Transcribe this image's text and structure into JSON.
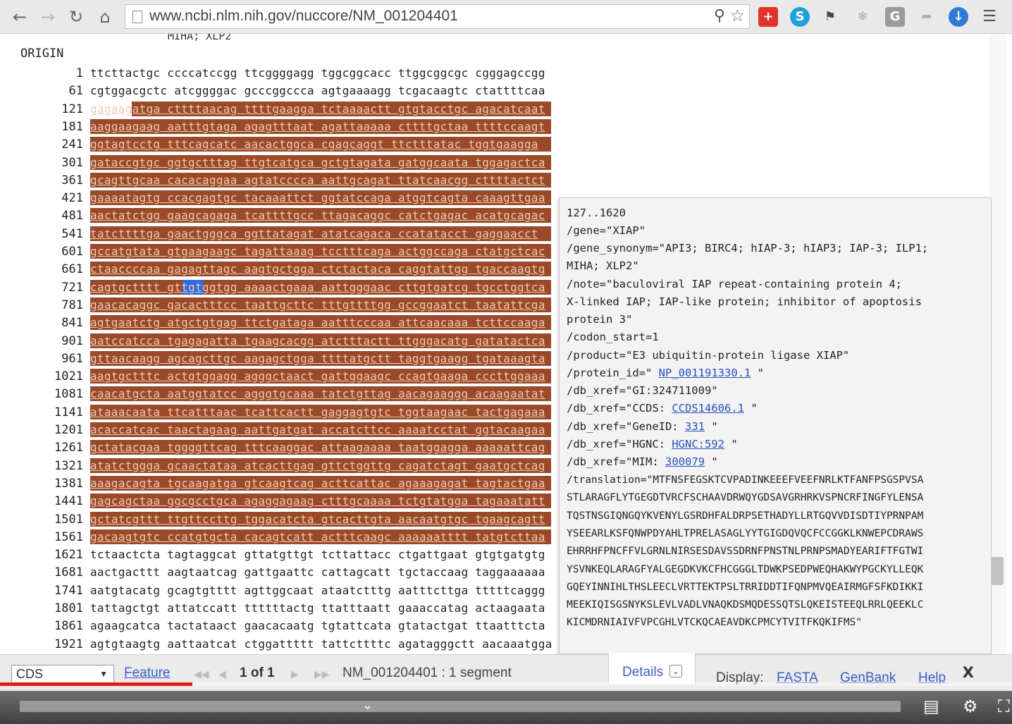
{
  "browser": {
    "url": "www.ncbi.nlm.nih.gov/nuccore/NM_001204401",
    "back_icon": "back-arrow-icon",
    "forward_icon": "forward-arrow-icon",
    "reload_icon": "reload-icon",
    "home_icon": "home-icon",
    "extensions": [
      "plus-extension-icon",
      "skype-icon",
      "puzzle-icon",
      "snowflake-icon",
      "g-icon",
      "share-icon",
      "download-icon",
      "menu-icon"
    ]
  },
  "sequence": {
    "cutoff_text": "MIHA; XLP2",
    "origin_label": "ORIGIN",
    "rows": [
      {
        "num": "1",
        "bases": "ttcttactgc ccccatccgg ttcggggagg tggcggcacc ttggcggcgc cgggagccgg",
        "hl": "none"
      },
      {
        "num": "61",
        "bases": "cgtggacgctc atcggggac gcccggccca agtgaaaagg tcgacaagtc ctattttcaa",
        "hl": "none"
      },
      {
        "num": "121",
        "bases": "gagaagatga cttttaacag ttttgaagga tctaaaactt gtgtacctgc agacatcaat",
        "hl": "part"
      },
      {
        "num": "181",
        "bases": "aaggaagaag aatttgtaga agagtttaat agattaaaaa cttttgctaa ttttccaagt",
        "hl": "full"
      },
      {
        "num": "241",
        "bases": "ggtagtcctg tttcagcatc aacactggca cgagcaggt ttctttatac tggtgaagga",
        "hl": "full"
      },
      {
        "num": "301",
        "bases": "gataccgtgc ggtgctttag ttgtcatgca gctgtagata gatggcaata tggagactca",
        "hl": "full"
      },
      {
        "num": "361",
        "bases": "gcagttgcaa cacacaggaa agtatcccca aattgcagat ttatcaacgg cttttactct",
        "hl": "full"
      },
      {
        "num": "421",
        "bases": "gaaaatagtg ccacgagtgc tacaaattct ggtatccaga atggtcagta caaagttgaa",
        "hl": "full"
      },
      {
        "num": "481",
        "bases": "aactatctgg gaagcagaga tcattttgcc ttagacaggc catctgagac acatgcagac",
        "hl": "full"
      },
      {
        "num": "541",
        "bases": "tatcttttga gaactgggca ggttatagat atatcagaca ccatatacct gaggaacct",
        "hl": "full"
      },
      {
        "num": "601",
        "bases": "gccatgtata gtgaagaagc tagattaaag tcctttcaga actggccaga ctatgctcac",
        "hl": "full"
      },
      {
        "num": "661",
        "bases": "ctaaccccaa gagagttagc aagtgctgga ctctactaca caggtattgg tgaccaagtg",
        "hl": "full"
      },
      {
        "num": "721",
        "bases": "cagtgctttt gttgtggtgg aaaactgaaa aattgggaac cttgtgatcg tgcctggtca",
        "hl": "full",
        "selected": true
      },
      {
        "num": "781",
        "bases": "gaacacaggc gacactttcc taattgcttc tttgttttgg gccggaatct taatattcga",
        "hl": "full"
      },
      {
        "num": "841",
        "bases": "agtgaatctg atgctgtgag ttctgataga aatttcccaa attcaacaaa tcttccaaga",
        "hl": "full"
      },
      {
        "num": "901",
        "bases": "aatccatcca tgagagatta tgaagcacgg atctttactt ttgggacatg gatatactca",
        "hl": "full"
      },
      {
        "num": "961",
        "bases": "gttaacaagg agcagcttgc aagagctgga ttttatgctt taggtgaagg tgataaagta",
        "hl": "full"
      },
      {
        "num": "1021",
        "bases": "aagtgctttc actgtggagg agggctaact gattggaagc ccagtgaaga cccttggaaa",
        "hl": "full"
      },
      {
        "num": "1081",
        "bases": "caacatgcta aatggtatcc agggtgcaaa tatctgttag aacagaaggg acaagaatat",
        "hl": "full"
      },
      {
        "num": "1141",
        "bases": "ataaacaata ttcatttaac tcattcactt gaggagtgtc tggtaagaac tactgagaaa",
        "hl": "full"
      },
      {
        "num": "1201",
        "bases": "acaccatcac taactagaag aattgatgat accatcttcc aaaatcctat ggtacaagaa",
        "hl": "full"
      },
      {
        "num": "1261",
        "bases": "gctatacgaa tggggttcag tttcaaggac attaagaaaa taatggagga aaaaattcag",
        "hl": "full"
      },
      {
        "num": "1321",
        "bases": "atatctggga gcaactataa atcacttgag gttctggttg cagatctagt gaatgctcag",
        "hl": "full"
      },
      {
        "num": "1381",
        "bases": "aaagacagta tgcaagatga gtcaagtcag acttcattac agaaagagat tagtactgaa",
        "hl": "full"
      },
      {
        "num": "1441",
        "bases": "gagcagctaa ggcgcctgca agaggagaag ctttgcaaaa tctgtatgga tagaaatatt",
        "hl": "full"
      },
      {
        "num": "1501",
        "bases": "gctatcgttt ttgttccttg tggacatcta gtcacttgta aacaatgtgc tgaagcagtt",
        "hl": "full"
      },
      {
        "num": "1561",
        "bases": "gacaagtgtc ccatgtgcta cacagtcatt actttcaagc aaaaaatttt tatgtcttaa",
        "hl": "full"
      },
      {
        "num": "1621",
        "bases": "tctaactcta tagtaggcat gttatgttgt tcttattacc ctgattgaat gtgtgatgtg",
        "hl": "none"
      },
      {
        "num": "1681",
        "bases": "aactgacttt aagtaatcag gattgaattc cattagcatt tgctaccaag taggaaaaaa",
        "hl": "none"
      },
      {
        "num": "1741",
        "bases": "aatgtacatg gcagtgtttt agttggcaat ataatctttg aatttcttga tttttcaggg",
        "hl": "none"
      },
      {
        "num": "1801",
        "bases": "tattagctgt attatccatt ttttttactg ttatttaatt gaaaccatag actaagaata",
        "hl": "none"
      },
      {
        "num": "1861",
        "bases": "agaagcatca tactataact gaacacaatg tgtattcata gtatactgat ttaatttcta",
        "hl": "none"
      },
      {
        "num": "1921",
        "bases": "agtgtaagtg aattaatcat ctggattttt tattcttttc agatagggctt aacaaatgga",
        "hl": "none"
      }
    ]
  },
  "popup": {
    "location": "127..1620",
    "gene": "/gene=\"XIAP\"",
    "synonym_1": "/gene_synonym=\"API3; BIRC4; hIAP-3; hIAP3; IAP-3; ILP1;",
    "synonym_2": "MIHA; XLP2\"",
    "note_1": "/note=\"baculoviral IAP repeat-containing protein 4;",
    "note_2": "X-linked IAP; IAP-like protein; inhibitor of apoptosis",
    "note_3": "protein 3\"",
    "codon_start": "/codon_start=1",
    "product": "/product=\"E3 ubiquitin-protein ligase XIAP\"",
    "protein_id_prefix": "/protein_id=\"",
    "protein_id": "NP_001191330.1",
    "db_xref_gi": "/db_xref=\"GI:324711009\"",
    "db_xref_ccds_prefix": "/db_xref=\"CCDS:",
    "db_xref_ccds": "CCDS14606.1",
    "db_xref_gene_prefix": "/db_xref=\"GeneID:",
    "db_xref_gene": "331",
    "db_xref_hgnc_prefix": "/db_xref=\"HGNC:",
    "db_xref_hgnc": "HGNC:592",
    "db_xref_mim_prefix": "/db_xref=\"MIM:",
    "db_xref_mim": "300079",
    "quote_close": "\"",
    "translation": [
      "/translation=\"MTFNSFEGSKTCVPADINKEEEFVEEFNRLKTFANFPSGSPVSA",
      "STLARAGFLYTGEGDTVRCFSCHAAVDRWQYGDSAVGRHRKVSPNCRFINGFYLENSA",
      "TQSTNSGIQNGQYKVENYLGSRDHFALDRPSETHADYLLRTGQVVDISDTIYPRNPAM",
      "YSEEARLKSFQNWPDYAHLTPRELASAGLYYTGIGDQVQCFCCGGKLKNWEPCDRAWS",
      "EHRRHFPNCFFVLGRNLNIRSESDAVSSDRNFPNSTNLPRNPSMADYEARIFTFGTWI",
      "YSVNKEQLARAGFYALGEGDKVKCFHCGGGLTDWKPSEDPWEQHAKWYPGCKYLLEQK",
      "GQEYINNIHLTHSLEECLVRTTEKTPSLTRRIDDTIFQNPMVQEAIRMGFSFKDIKKI",
      "MEEKIQISGSNYKSLEVLVADLVNAQKDSMQDESSQTSLQKEISTEEQLRRLQEEKLC",
      "KICMDRNIAIVFVPCGHLVTCKQCAEAVDKCPMCYTVITFKQKIFMS\""
    ]
  },
  "bottom": {
    "select_value": "CDS",
    "feature_link": "Feature",
    "page_counter": "1 of 1",
    "accession": "NM_001204401 : 1 segment",
    "details_label": "Details",
    "display_label": "Display:",
    "fasta_link": "FASTA",
    "genbank_link": "GenBank",
    "help_link": "Help",
    "close_label": "X"
  },
  "player": {
    "progress": 0.19
  },
  "colors": {
    "highlight": "#9a4a28",
    "selection": "#2e6ae0",
    "link": "#3a5fc6"
  }
}
